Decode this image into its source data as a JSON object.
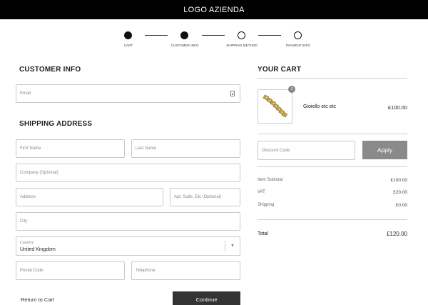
{
  "header": {
    "logo_text": "LOGO AZIENDA"
  },
  "steps": [
    {
      "label": "CART",
      "state": "complete"
    },
    {
      "label": "CUSTOMER INFO",
      "state": "current"
    },
    {
      "label": "SHIPPING METHOD",
      "state": "upcoming"
    },
    {
      "label": "PAYMENT INFO",
      "state": "upcoming"
    }
  ],
  "customer_info": {
    "title": "CUSTOMER INFO",
    "email_placeholder": "Email",
    "email_icon": "contact-card-icon"
  },
  "shipping_address": {
    "title": "SHIPPING ADDRESS",
    "first_name_placeholder": "First Name",
    "last_name_placeholder": "Last Name",
    "company_placeholder": "Company (Optional)",
    "address_placeholder": "Address",
    "apt_placeholder": "Apt, Suite, Etc (Optional)",
    "city_placeholder": "City",
    "country_label": "Country",
    "country_value": "United Kingdom",
    "postal_placeholder": "Postal Code",
    "telephone_placeholder": "Telephone"
  },
  "actions": {
    "return_label": "Return to Cart",
    "continue_label": "Continue"
  },
  "cart": {
    "title": "YOUR CART",
    "item": {
      "name": "Gioiello etc etc",
      "price": "£100.00",
      "quantity": "1",
      "image_icon": "bracelet-image"
    },
    "discount_placeholder": "Discount Code",
    "apply_label": "Apply",
    "summary": [
      {
        "label": "Item Subtotal",
        "value": "£100.00"
      },
      {
        "label": "VAT",
        "value": "£20.00"
      },
      {
        "label": "Shipping",
        "value": "£0.00"
      }
    ],
    "total_label": "Total",
    "total_value": "£120.00"
  },
  "colors": {
    "header_bg": "#000000",
    "continue_bg": "#333333",
    "apply_bg": "#8a8a8a",
    "badge_bg": "#888888"
  }
}
